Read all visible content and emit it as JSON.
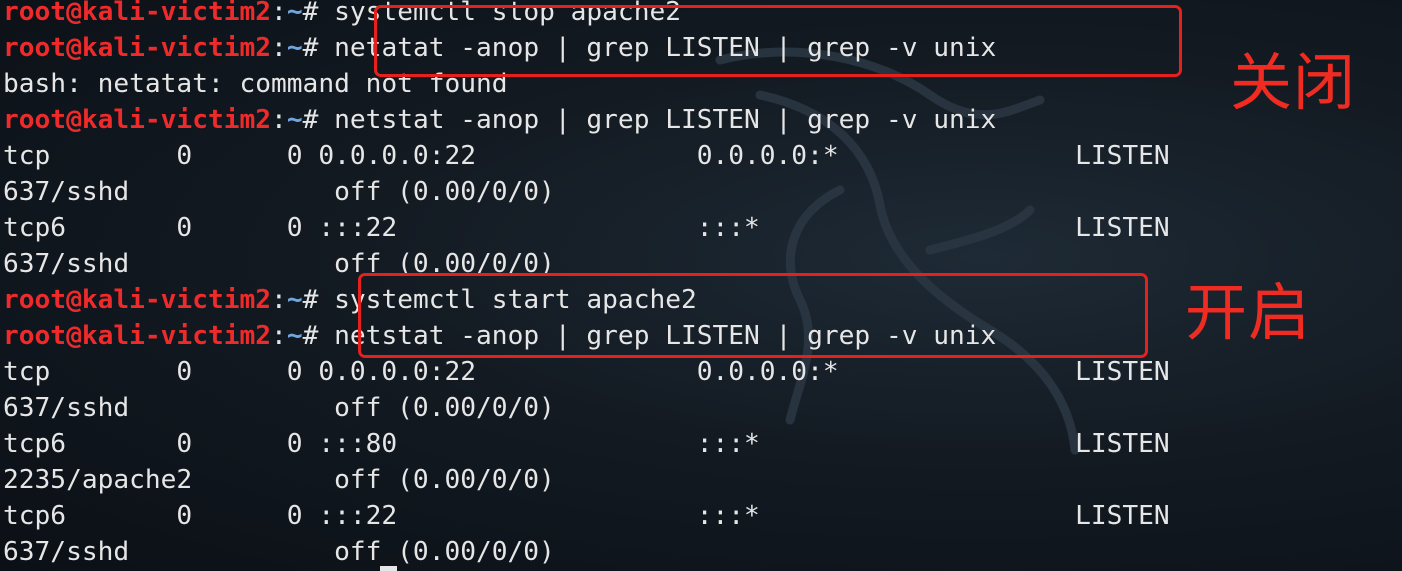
{
  "prompt": {
    "user": "root@kali-victim2",
    "sep": ":",
    "path": "~",
    "symbol": "# "
  },
  "lines": [
    {
      "type": "cmd",
      "text": "systemctl stop apache2"
    },
    {
      "type": "cmd",
      "text": "netatat -anop | grep LISTEN | grep -v unix"
    },
    {
      "type": "out",
      "text": "bash: netatat: command not found"
    },
    {
      "type": "cmd",
      "text": "netstat -anop | grep LISTEN | grep -v unix"
    },
    {
      "type": "out",
      "text": "tcp        0      0 0.0.0.0:22              0.0.0.0:*               LISTEN"
    },
    {
      "type": "out",
      "text": "637/sshd             off (0.00/0/0)"
    },
    {
      "type": "out",
      "text": "tcp6       0      0 :::22                   :::*                    LISTEN"
    },
    {
      "type": "out",
      "text": "637/sshd             off (0.00/0/0)"
    },
    {
      "type": "cmd",
      "text": "systemctl start apache2"
    },
    {
      "type": "cmd",
      "text": "netstat -anop | grep LISTEN | grep -v unix"
    },
    {
      "type": "out",
      "text": "tcp        0      0 0.0.0.0:22              0.0.0.0:*               LISTEN"
    },
    {
      "type": "out",
      "text": "637/sshd             off (0.00/0/0)"
    },
    {
      "type": "out",
      "text": "tcp6       0      0 :::80                   :::*                    LISTEN"
    },
    {
      "type": "out",
      "text": "2235/apache2         off (0.00/0/0)"
    },
    {
      "type": "out",
      "text": "tcp6       0      0 :::22                   :::*                    LISTEN"
    },
    {
      "type": "out",
      "text": "637/sshd             off (0.00/0/0)"
    }
  ],
  "annotations": {
    "close_label": "关闭",
    "open_label": "开启"
  },
  "colors": {
    "annotation": "#e5201d",
    "user": "#ee2a2a",
    "path": "#6fa6e0",
    "text": "#e6e6e6"
  }
}
